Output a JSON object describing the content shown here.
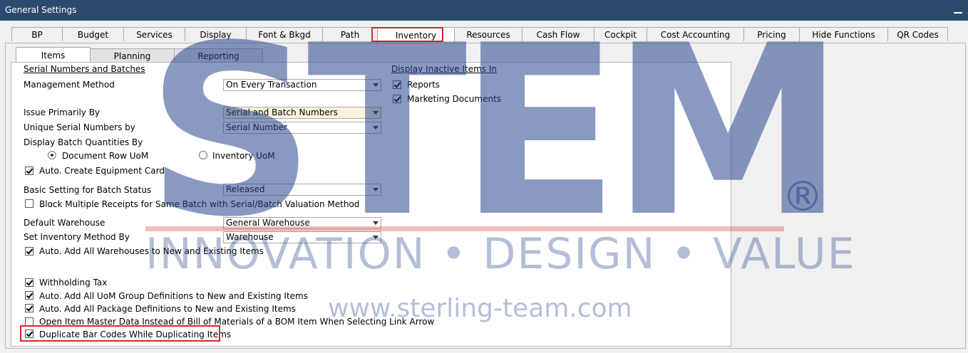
{
  "window": {
    "title": "General Settings"
  },
  "outer_tabs": [
    "BP",
    "Budget",
    "Services",
    "Display",
    "Font & Bkgd",
    "Path",
    "Inventory",
    "Resources",
    "Cash Flow",
    "Cockpit",
    "Cost Accounting",
    "Pricing",
    "Hide Functions",
    "QR Codes"
  ],
  "inner_tabs": [
    "Items",
    "Planning",
    "Reporting"
  ],
  "serial": {
    "heading": "Serial Numbers and Batches",
    "management_method_label": "Management Method",
    "management_method_value": "On Every Transaction",
    "issue_primarily_label": "Issue Primarily By",
    "issue_primarily_value": "Serial and Batch Numbers",
    "unique_serial_label": "Unique Serial Numbers by",
    "unique_serial_value": "Serial Number",
    "display_batch_label": "Display Batch Quantities By",
    "radio_doc_row": "Document Row UoM",
    "radio_inventory": "Inventory UoM",
    "auto_equipment_card": "Auto. Create Equipment Card",
    "batch_status_label": "Basic Setting for Batch Status",
    "batch_status_value": "Released",
    "block_receipts": "Block Multiple Receipts for Same Batch with Serial/Batch Valuation Method",
    "default_warehouse_label": "Default Warehouse",
    "default_warehouse_value": "General Warehouse",
    "inventory_method_label": "Set Inventory Method By",
    "inventory_method_value": "Warehouse",
    "auto_add_warehouses": "Auto. Add All Warehouses to New and Existing Items",
    "withholding_tax": "Withholding Tax",
    "auto_add_uom": "Auto. Add All UoM Group Definitions to New and Existing Items",
    "auto_add_package": "Auto. Add All Package Definitions to New and Existing Items",
    "open_item_master": "Open Item Master Data Instead of Bill of Materials of a BOM Item When Selecting Link Arrow",
    "duplicate_bar_codes": "Duplicate Bar Codes While Duplicating Items"
  },
  "inactive": {
    "heading": "Display Inactive Items In",
    "reports": "Reports",
    "marketing_docs": "Marketing Documents"
  },
  "watermark": {
    "logo": "STEM",
    "registered": "®",
    "tagline": "INNOVATION • DESIGN • VALUE",
    "url": "www.sterling-team.com"
  }
}
